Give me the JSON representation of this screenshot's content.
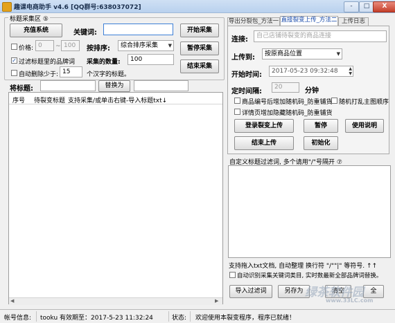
{
  "window": {
    "title": "趣课电商助手 v4.6 [QQ群号:638037072]",
    "minimize": "-",
    "maximize": "□",
    "close": "X"
  },
  "collect": {
    "group_label": "标题采集区 ⑤",
    "recharge_button": "充值系统",
    "keyword_label": "关键词:",
    "keyword_value": "",
    "start_button": "开始采集",
    "price_label": "价格:",
    "price_min": "0",
    "price_tilde": "~",
    "price_max": "100",
    "sort_label": "按排序:",
    "sort_value": "综合排序采集",
    "pause_button": "暂停采集",
    "filter_brand_label": "过滤标题里的品牌词",
    "count_label": "采集的数量:",
    "count_value": "100",
    "end_button": "结束采集",
    "auto_delete_label": "自动删除少于:",
    "auto_delete_value": "15",
    "auto_delete_suffix": "个汉字的标题。",
    "title_label": "将标题:",
    "title_from": "",
    "replace_button": "替换为",
    "title_to": ""
  },
  "table": {
    "columns": [
      "序号",
      "待裂变标题",
      "支持采集/或单击右键-导入标题txt↓"
    ]
  },
  "tabs": [
    {
      "label": "导出分裂包_方法一"
    },
    {
      "label": "直接裂变上传_方法二"
    },
    {
      "label": "上传日志"
    }
  ],
  "upload": {
    "link_label": "连接:",
    "link_placeholder": "自己店铺待裂变的商品连接",
    "upload_to_label": "上传到:",
    "upload_to_value": "按原商品位置",
    "start_time_label": "开始时间:",
    "start_time_value": "2017-05-23 09:32:48",
    "interval_label": "定时间隔:",
    "interval_value": "20",
    "interval_unit": "分钟",
    "opt_random_code": "商品编号后增加随机码_防重铺货",
    "opt_shuffle_images": "随机打乱主图顺序",
    "opt_hidden_code": "详情页增加隐藏随机码_防重铺货",
    "login_button": "登录裂变上传",
    "pause_button": "暂停",
    "help_button": "使用说明",
    "end_button": "结束上传",
    "init_button": "初始化"
  },
  "filter_words": {
    "label": "自定义标题过滤词, 多个请用\"/\"号隔开 ⑦",
    "value": "",
    "hint": "支持拖入txt文档, 自动整理 换行符 \"/\"\"|\" 等符号. ↑↑",
    "auto_identify_label": "自动识别采集关键词类目, 实时数最新全部品牌词替换。",
    "import_button": "导入过滤词",
    "save_button": "另存为",
    "clear_button": "清空",
    "extra_button": "全"
  },
  "status": {
    "account_label": "帐号信息:",
    "account_value": "tooku 有效期至：2017-5-23 11:32:24",
    "state_label": "状态:",
    "state_value": "欢迎使用本裂变程序，程序已就绪！"
  },
  "watermark": {
    "text": "绿茶软件园",
    "sub": "www.33LC.com"
  }
}
